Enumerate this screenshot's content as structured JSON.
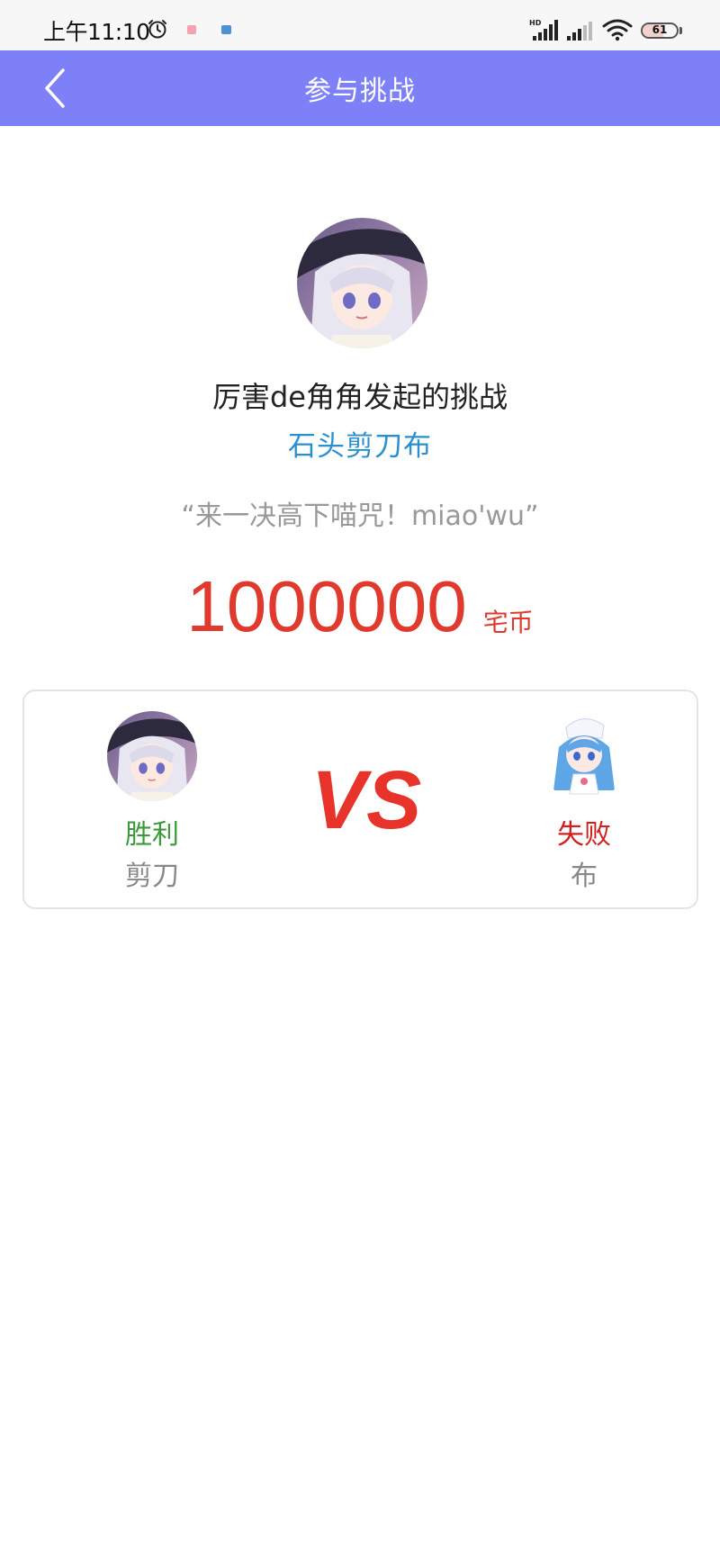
{
  "status_bar": {
    "time": "上午11:10",
    "battery": "61",
    "battery_level": 0.61
  },
  "header": {
    "title": "参与挑战"
  },
  "challenge": {
    "creator_name": "厉害de角角发起的挑战",
    "game_type": "石头剪刀布",
    "message": "“来一决高下喵咒！miao'wu”",
    "stake_amount": "1000000",
    "stake_unit": "宅币"
  },
  "result": {
    "vs_label": "VS",
    "left_player": {
      "result": "胜利",
      "move": "剪刀"
    },
    "right_player": {
      "result": "失败",
      "move": "布"
    }
  },
  "colors": {
    "header_bg": "#7e80f8",
    "game_type": "#2a8fd0",
    "stake": "#e03a2f",
    "win": "#3a9a3a",
    "lose": "#d21e1e",
    "vs": "#e8332a"
  }
}
